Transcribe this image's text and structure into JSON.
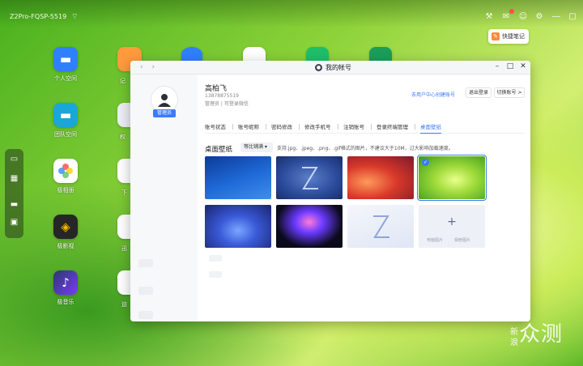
{
  "topbar": {
    "device_name": "Z2Pro-FQSP-5519"
  },
  "quick_note": {
    "label": "快捷笔记"
  },
  "desktop": {
    "apps": [
      {
        "label": "个人空间",
        "color": "#2f80ff"
      },
      {
        "label": "团队空间",
        "color": "#1aa7d8"
      },
      {
        "label": "极相册",
        "color": "#ffffff"
      },
      {
        "label": "极影视",
        "color": "#262626"
      },
      {
        "label": "极音乐",
        "color": "#1a2a4a"
      }
    ],
    "partial_labels": [
      "记",
      "权",
      "下",
      "迅",
      "迫"
    ]
  },
  "window": {
    "title": "我的帐号",
    "user": {
      "name": "高柏飞",
      "phone": "13878875519",
      "role_line": "管理员 | 可登录微信",
      "role_badge": "管理员"
    },
    "links": {
      "user_center": "去用户中心创建账号"
    },
    "buttons": {
      "logout": "退出登录",
      "switch_account": "切换账号 >"
    },
    "tabs": [
      "账号状态",
      "账号昵称",
      "密码修改",
      "修改手机号",
      "注销账号",
      "登录终端管理",
      "桌面壁纸"
    ],
    "active_tab": "桌面壁纸",
    "section": {
      "title": "桌面壁纸",
      "dropdown": "等比铺满 ▾",
      "hint": "支持.jpg、.jpeg、.png、.gif格式的图片，不建议大于10M，过大影响加载速度。"
    },
    "wallpapers": [
      {
        "name": "blue-gradient",
        "selected": false
      },
      {
        "name": "z-logo-blue",
        "selected": false
      },
      {
        "name": "red-orange-wave",
        "selected": false
      },
      {
        "name": "green-leaf",
        "selected": true
      },
      {
        "name": "blue-flower",
        "selected": false
      },
      {
        "name": "jellyfish",
        "selected": false
      },
      {
        "name": "z-logo-light",
        "selected": false
      }
    ],
    "add_tile": {
      "local_label": "电脑图片",
      "upload_label": "相册图片"
    }
  },
  "watermark": {
    "line1": "新",
    "line2": "浪",
    "text": "众测"
  },
  "colors": {
    "accent": "#3a7bff",
    "desktop_green": "#8fd33a"
  }
}
